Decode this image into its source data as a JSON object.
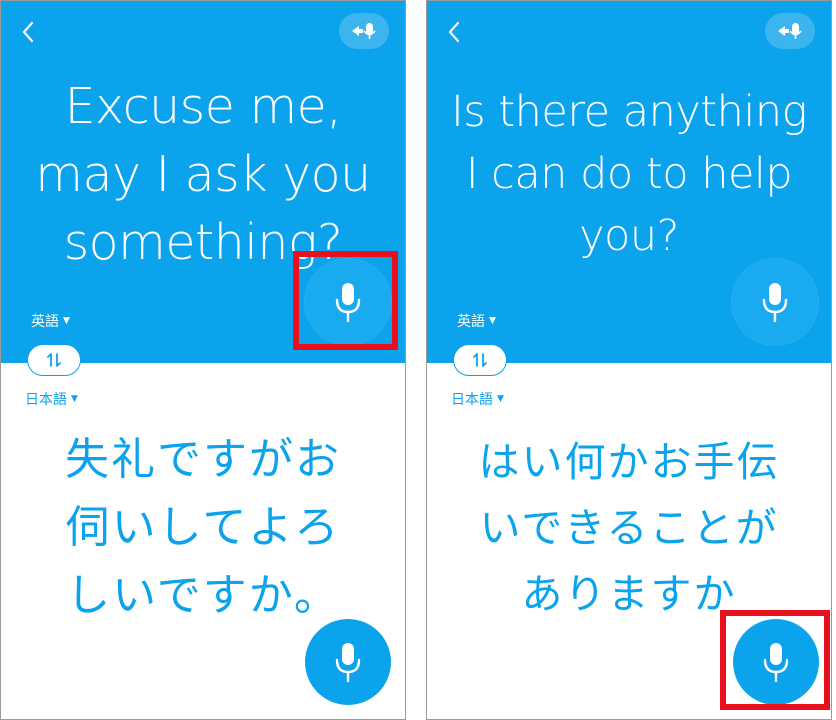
{
  "panels": [
    {
      "source_lines": [
        "Excuse me,",
        "may I ask you",
        "something?"
      ],
      "source_language": "英語",
      "target_language": "日本語",
      "target_lines": [
        "失礼ですがお",
        "伺いしてよろ",
        "しいですか。"
      ]
    },
    {
      "source_lines": [
        "Is there anything",
        "I can do to help",
        "you?"
      ],
      "source_language": "英語",
      "target_language": "日本語",
      "target_lines": [
        "はい何かお手伝",
        "いできることが",
        "ありますか"
      ]
    }
  ],
  "icons": {
    "back": "back-chevron-icon",
    "mode": "mic-arrow-icon",
    "swap": "swap-arrows-icon",
    "mic": "microphone-icon"
  },
  "colors": {
    "accent": "#0ba3ec",
    "highlight": "#e8101d"
  }
}
